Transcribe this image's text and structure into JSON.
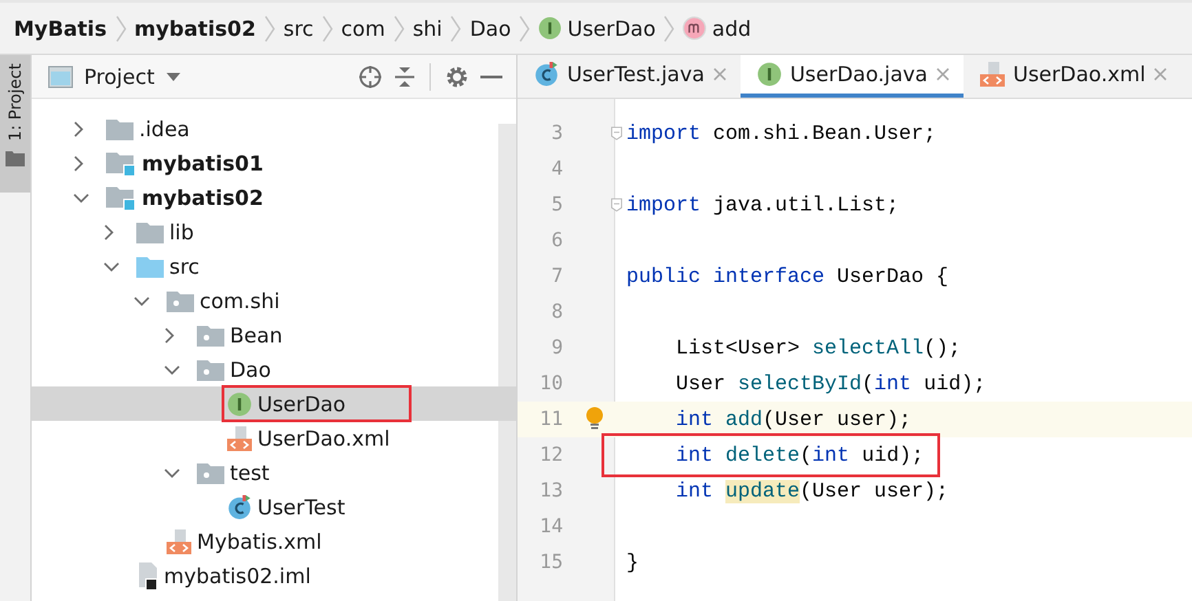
{
  "breadcrumbs": [
    {
      "label": "MyBatis",
      "kind": "project"
    },
    {
      "label": "mybatis02",
      "kind": "module"
    },
    {
      "label": "src",
      "kind": "folder"
    },
    {
      "label": "com",
      "kind": "folder"
    },
    {
      "label": "shi",
      "kind": "folder"
    },
    {
      "label": "Dao",
      "kind": "folder"
    },
    {
      "label": "UserDao",
      "kind": "interface"
    },
    {
      "label": "add",
      "kind": "method"
    }
  ],
  "side_tab": {
    "label": "1: Project",
    "selected": true
  },
  "project_panel": {
    "title": "Project",
    "tree": [
      {
        "name": ".idea",
        "kind": "folder",
        "expanded": false,
        "selected": false,
        "annotated": false
      },
      {
        "name": "mybatis01",
        "kind": "module",
        "expanded": false,
        "selected": false,
        "annotated": false
      },
      {
        "name": "mybatis02",
        "kind": "module",
        "expanded": true,
        "selected": false,
        "annotated": false,
        "children": [
          {
            "name": "lib",
            "kind": "folder",
            "expanded": false,
            "selected": false,
            "annotated": false
          },
          {
            "name": "src",
            "kind": "source",
            "expanded": true,
            "selected": false,
            "annotated": false,
            "children": [
              {
                "name": "com.shi",
                "kind": "package",
                "expanded": true,
                "selected": false,
                "annotated": false,
                "children": [
                  {
                    "name": "Bean",
                    "kind": "package",
                    "expanded": false,
                    "selected": false,
                    "annotated": false
                  },
                  {
                    "name": "Dao",
                    "kind": "package",
                    "expanded": true,
                    "selected": false,
                    "annotated": false,
                    "children": [
                      {
                        "name": "UserDao",
                        "kind": "interface",
                        "selected": true,
                        "annotated": true
                      },
                      {
                        "name": "UserDao.xml",
                        "kind": "xml",
                        "selected": false,
                        "annotated": false
                      }
                    ]
                  },
                  {
                    "name": "test",
                    "kind": "package",
                    "expanded": true,
                    "selected": false,
                    "annotated": false,
                    "children": [
                      {
                        "name": "UserTest",
                        "kind": "class",
                        "selected": false,
                        "annotated": false
                      }
                    ]
                  }
                ]
              },
              {
                "name": "Mybatis.xml",
                "kind": "xml",
                "selected": false,
                "annotated": false
              }
            ]
          },
          {
            "name": "mybatis02.iml",
            "kind": "iml",
            "selected": false,
            "annotated": false
          }
        ]
      }
    ]
  },
  "editor": {
    "tabs": [
      {
        "label": "UserTest.java",
        "kind": "class",
        "selected": false
      },
      {
        "label": "UserDao.java",
        "kind": "interface",
        "selected": true
      },
      {
        "label": "UserDao.xml",
        "kind": "xml",
        "selected": false
      }
    ],
    "lines": [
      {
        "number": "3",
        "fold": true,
        "current": false,
        "annotated": false,
        "tokens": [
          {
            "text": "import",
            "kind": "keyword"
          },
          {
            "text": " com.shi.Bean.User;",
            "kind": "plain"
          }
        ]
      },
      {
        "number": "4",
        "fold": false,
        "current": false,
        "annotated": false
      },
      {
        "number": "5",
        "fold": true,
        "current": false,
        "annotated": false,
        "tokens": [
          {
            "text": "import",
            "kind": "keyword"
          },
          {
            "text": " java.util.List;",
            "kind": "plain"
          }
        ]
      },
      {
        "number": "6",
        "fold": false,
        "current": false,
        "annotated": false
      },
      {
        "number": "7",
        "fold": false,
        "current": false,
        "annotated": false,
        "tokens": [
          {
            "text": "public interface",
            "kind": "keyword"
          },
          {
            "text": " UserDao {",
            "kind": "plain"
          }
        ]
      },
      {
        "number": "8",
        "fold": false,
        "current": false,
        "annotated": false
      },
      {
        "number": "9",
        "fold": false,
        "current": false,
        "annotated": false,
        "tokens": [
          {
            "text": "    List<User> ",
            "kind": "plain"
          },
          {
            "text": "selectAll",
            "kind": "method"
          },
          {
            "text": "();",
            "kind": "plain"
          }
        ]
      },
      {
        "number": "10",
        "fold": false,
        "current": false,
        "annotated": false,
        "tokens": [
          {
            "text": "    User ",
            "kind": "plain"
          },
          {
            "text": "selectById",
            "kind": "method"
          },
          {
            "text": "(",
            "kind": "plain"
          },
          {
            "text": "int",
            "kind": "keyword"
          },
          {
            "text": " uid);",
            "kind": "plain"
          }
        ]
      },
      {
        "number": "11",
        "fold": false,
        "current": true,
        "annotated": false,
        "tokens": [
          {
            "text": "    int ",
            "kind": "keyword"
          },
          {
            "text": "add",
            "kind": "method"
          },
          {
            "text": "(User user);",
            "kind": "plain"
          }
        ]
      },
      {
        "number": "12",
        "fold": false,
        "current": false,
        "annotated": true,
        "tokens": [
          {
            "text": "    int ",
            "kind": "keyword"
          },
          {
            "text": "delete",
            "kind": "method"
          },
          {
            "text": "(",
            "kind": "plain"
          },
          {
            "text": "int",
            "kind": "keyword"
          },
          {
            "text": " uid);",
            "kind": "plain"
          }
        ]
      },
      {
        "number": "13",
        "fold": false,
        "current": false,
        "annotated": false,
        "tokens": [
          {
            "text": "    int ",
            "kind": "keyword"
          },
          {
            "text": "update",
            "kind": "method_marked"
          },
          {
            "text": "(User user);",
            "kind": "plain"
          }
        ]
      },
      {
        "number": "14",
        "fold": false,
        "current": false,
        "annotated": false
      },
      {
        "number": "15",
        "fold": false,
        "current": false,
        "annotated": false,
        "tokens": [
          {
            "text": "}",
            "kind": "plain"
          }
        ]
      }
    ]
  }
}
